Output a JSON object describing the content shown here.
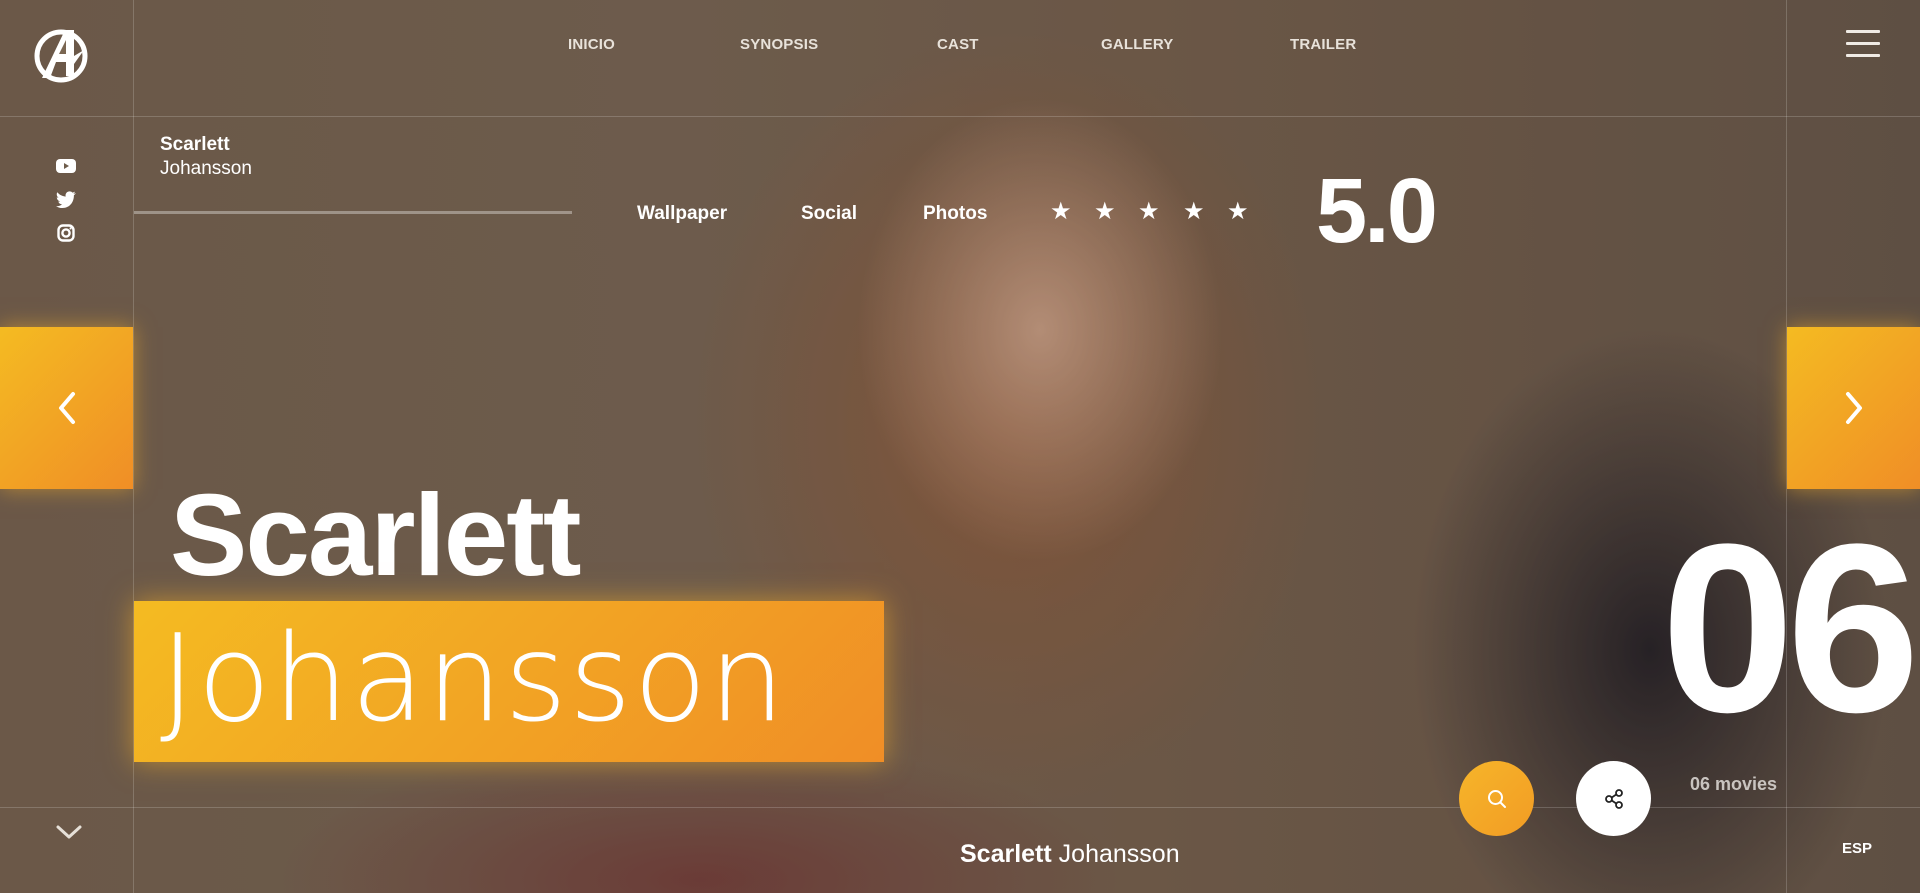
{
  "nav": {
    "items": [
      "INICIO",
      "SYNOPSIS",
      "CAST",
      "GALLERY",
      "TRAILER"
    ]
  },
  "social": [
    "youtube-icon",
    "twitter-icon",
    "instagram-icon"
  ],
  "actor": {
    "first_name": "Scarlett",
    "last_name": "Johansson"
  },
  "subnav": {
    "items": [
      "Wallpaper",
      "Social",
      "Photos"
    ]
  },
  "rating": {
    "stars": 5,
    "value": "5.0"
  },
  "counter": {
    "number": "06",
    "movies_label": "06 movies"
  },
  "language": "ESP",
  "colors": {
    "accent_start": "#f4bb22",
    "accent_end": "#f08e26",
    "text": "#ffffff"
  }
}
